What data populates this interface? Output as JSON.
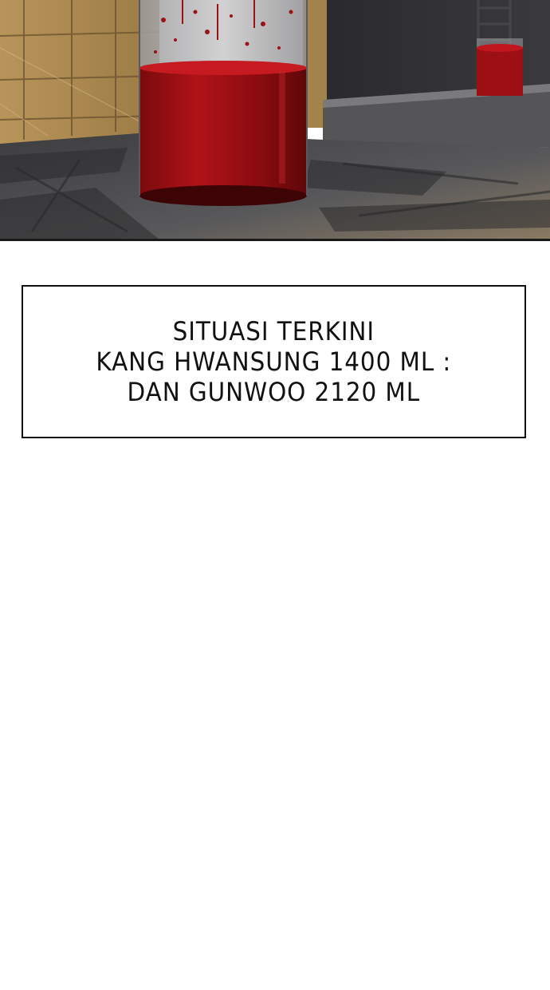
{
  "caption": {
    "lines": [
      "SITUASI TERKINI",
      "KANG HWANSUNG 1400 ML :",
      "DAN GUNWOO 2120 ML"
    ]
  },
  "colors": {
    "blood": "#8e0e12",
    "floor": "#4a4a4c",
    "wall": "#a8874f",
    "border": "#111111"
  }
}
